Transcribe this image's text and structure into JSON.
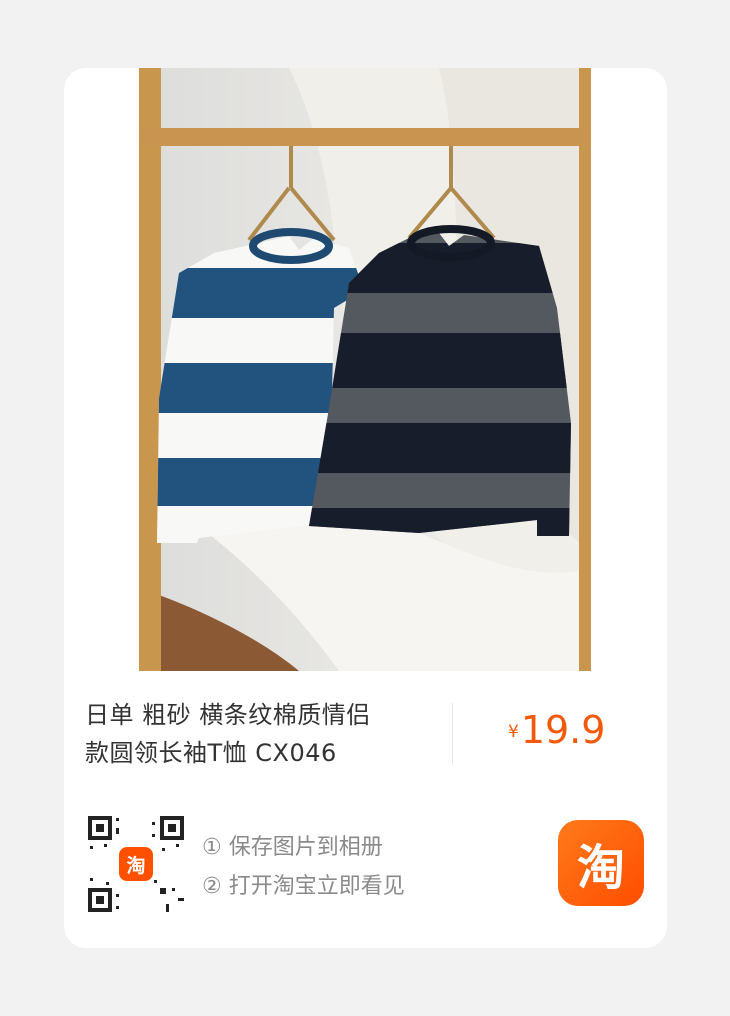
{
  "product": {
    "title_line1": "日单 粗砂 横条纹棉质情侣",
    "title_line2": "款圆领长袖T恤 CX046",
    "price_symbol": "¥",
    "price": "19.9"
  },
  "instructions": {
    "step1": "① 保存图片到相册",
    "step2": "② 打开淘宝立即看见"
  },
  "qr_badge": "淘",
  "app_icon_char": "淘",
  "colors": {
    "price": "#f25a0b",
    "taobao_orange": "#ff5000"
  }
}
